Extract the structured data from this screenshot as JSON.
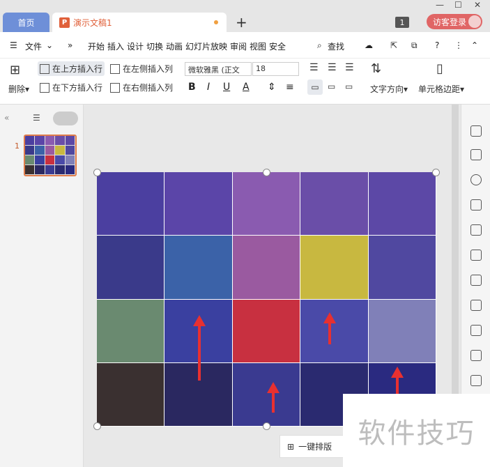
{
  "tabs": {
    "home": "首页",
    "doc": "演示文稿1"
  },
  "window": {
    "badge": "1",
    "login": "访客登录"
  },
  "menu": {
    "file": "文件",
    "items": [
      "开始",
      "插入",
      "设计",
      "切换",
      "动画",
      "幻灯片放映",
      "审阅",
      "视图",
      "安全"
    ],
    "search": "查找"
  },
  "ribbon": {
    "delete": "删除",
    "insert_above": "在上方插入行",
    "insert_below": "在下方插入行",
    "insert_left": "在左侧插入列",
    "insert_right": "在右侧插入列",
    "font": "微软雅黑 (正文",
    "size": "18",
    "text_dir": "文字方向",
    "cell_margin": "单元格边距",
    "bold": "B",
    "italic": "I",
    "underline": "U",
    "color": "A"
  },
  "slides": {
    "number": "1"
  },
  "canvas": {
    "one_key": "一键排版"
  },
  "watermark": "软件技巧",
  "colors": {
    "accent": "#e0603a",
    "home_tab": "#6e8fd8",
    "login": "#e06565",
    "arrow": "#e83030"
  }
}
